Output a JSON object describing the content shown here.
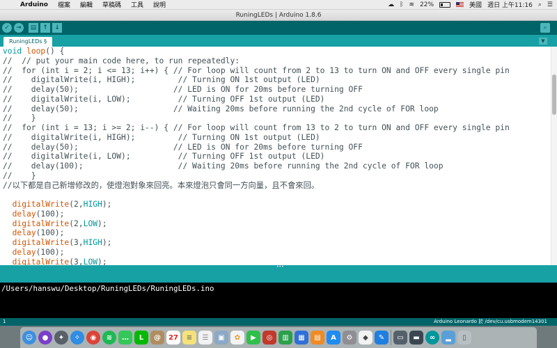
{
  "menubar": {
    "apple_icon": "apple-icon",
    "items": [
      "Arduino",
      "檔案",
      "編輯",
      "草稿碼",
      "工具",
      "說明"
    ],
    "battery_percent": "22%",
    "input_method": "美國",
    "clock": "週日 上午11:16"
  },
  "window": {
    "title": "RuningLEDs | Arduino 1.8.6"
  },
  "toolbar": {
    "buttons": [
      "verify-icon",
      "upload-icon",
      "new-icon",
      "open-icon",
      "save-icon"
    ],
    "serial_monitor_icon": "magnifier-icon"
  },
  "tab": {
    "label": "RuningLEDs §"
  },
  "code_lines": [
    "void loop() {",
    "//  // put your main code here, to run repeatedly:",
    "//  for (int i = 2; i <= 13; i++) { // For loop will count from 2 to 13 to turn ON and OFF every single pin",
    "//    digitalWrite(i, HIGH);         // Turning ON 1st output (LED)",
    "//    delay(50);                    // LED is ON for 20ms before turning OFF",
    "//    digitalWrite(i, LOW);          // Turning OFF 1st output (LED)",
    "//    delay(50);                    // Waiting 20ms before running the 2nd cycle of FOR loop",
    "//    }",
    "//  for (int i = 13; i >= 2; i--) { // For loop will count from 13 to 2 to turn ON and OFF every single pin",
    "//    digitalWrite(i, HIGH);         // Turning ON 1st output (LED)",
    "//    delay(50);                    // LED is ON for 20ms before turning OFF",
    "//    digitalWrite(i, LOW);          // Turning OFF 1st output (LED)",
    "//    delay(100);                    // Waiting 20ms before running the 2nd cycle of FOR loop",
    "//    }",
    "//以下都是自己新增修改的，使燈泡對象來回亮。本來燈泡只會同一方向量，且不會來回。",
    "",
    "  digitalWrite(2,HIGH);",
    "  delay(100);",
    "  digitalWrite(2,LOW);",
    "  delay(100);",
    "  digitalWrite(3,HIGH);",
    "  delay(100);",
    "  digitalWrite(3,LOW);"
  ],
  "console": {
    "line": "/Users/hanswu/Desktop/RuningLEDs/RuningLEDs.ino"
  },
  "status": {
    "line_number": "1",
    "board": "Arduino Leonardo 於 /dev/cu.usbmodem14301"
  },
  "dock": {
    "icons": [
      {
        "name": "finder-icon",
        "color": "#3d8fe0",
        "glyph": "☺"
      },
      {
        "name": "siri-icon",
        "color": "#7a3fc8",
        "glyph": "●"
      },
      {
        "name": "launchpad-icon",
        "color": "#58606a",
        "glyph": "✦"
      },
      {
        "name": "safari-icon",
        "color": "#2f8de4",
        "glyph": "✧"
      },
      {
        "name": "chrome-icon",
        "color": "#db4437",
        "glyph": "◉"
      },
      {
        "name": "spotify-icon",
        "color": "#1db954",
        "glyph": "≋"
      },
      {
        "name": "messages-icon",
        "color": "#35c759",
        "glyph": "…"
      },
      {
        "name": "line-icon",
        "color": "#00b900",
        "glyph": "L"
      },
      {
        "name": "contacts-icon",
        "color": "#b08d60",
        "glyph": "@"
      },
      {
        "name": "calendar-icon",
        "color": "#ffffff",
        "glyph": "27",
        "text": "#d22"
      },
      {
        "name": "notes-icon",
        "color": "#f5e27a",
        "glyph": "≡",
        "text": "#776"
      },
      {
        "name": "reminders-icon",
        "color": "#f2f2f2",
        "glyph": "☰",
        "text": "#888"
      },
      {
        "name": "preview-icon",
        "color": "#8aa8c8",
        "glyph": "▣"
      },
      {
        "name": "photos-icon",
        "color": "#f3f3f3",
        "glyph": "✿",
        "text": "#e59a2a"
      },
      {
        "name": "facetime-icon",
        "color": "#2fbf4a",
        "glyph": "▶"
      },
      {
        "name": "photo-booth-icon",
        "color": "#c0392b",
        "glyph": "◎"
      },
      {
        "name": "numbers-icon",
        "color": "#2aa04a",
        "glyph": "▥"
      },
      {
        "name": "keynote-icon",
        "color": "#2f6fd6",
        "glyph": "▦"
      },
      {
        "name": "ibooks-icon",
        "color": "#f08a24",
        "glyph": "▤"
      },
      {
        "name": "app-store-icon",
        "color": "#1e8cf0",
        "glyph": "A"
      },
      {
        "name": "system-preferences-icon",
        "color": "#8e8e93",
        "glyph": "⚙"
      },
      {
        "name": "roblox-icon",
        "color": "#f2f2f2",
        "glyph": "◆",
        "text": "#444"
      },
      {
        "name": "xcode-icon",
        "color": "#1e7fe0",
        "glyph": "✎"
      },
      {
        "name": "screenshot-icon",
        "color": "#54606a",
        "glyph": "▭"
      },
      {
        "name": "monitor-icon",
        "color": "#3a4650",
        "glyph": "▬"
      },
      {
        "name": "arduino-icon",
        "color": "#00979c",
        "glyph": "∞"
      },
      {
        "name": "folder-icon",
        "color": "#5a9fd8",
        "glyph": "▂"
      },
      {
        "name": "trash-icon",
        "color": "#b8c0c4",
        "glyph": "▯",
        "text": "#555"
      }
    ]
  }
}
